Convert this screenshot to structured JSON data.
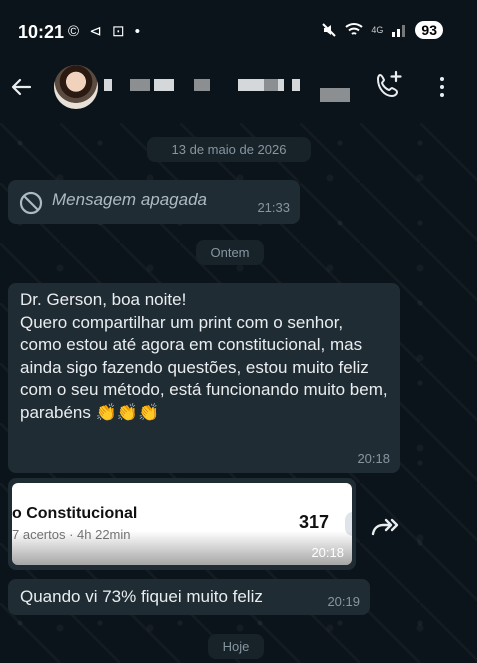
{
  "status_bar": {
    "time": "10:21",
    "left_icons": "© ⊲ ⊡ •",
    "network": "4G",
    "battery": "93"
  },
  "header": {
    "back_icon": "arrow-left-icon",
    "call_icon": "add-call-icon",
    "menu_icon": "more-vertical-icon"
  },
  "chat": {
    "date_1": "13 de maio de 2026",
    "deleted_message": {
      "text": "Mensagem apagada",
      "time": "21:33"
    },
    "date_2": "Ontem",
    "message_1": {
      "text": "Dr. Gerson, boa noite!\nQuero compartilhar um print com o senhor, como estou até agora em constitucional, mas ainda sigo fazendo questões, estou muito feliz com o seu método, está funcionando muito bem, parabéns 👏👏👏",
      "time": "20:18"
    },
    "image_message": {
      "title": "o Constitucional",
      "subtitle": "7 acertos · 4h 22min",
      "number": "317",
      "time": "20:18"
    },
    "message_2": {
      "text": "Quando vi 73% fiquei muito feliz",
      "time": "20:19"
    },
    "date_3": "Hoje"
  },
  "colors": {
    "background": "#0b141a",
    "bubble": "#202c33",
    "meta_text": "#8696a0"
  }
}
